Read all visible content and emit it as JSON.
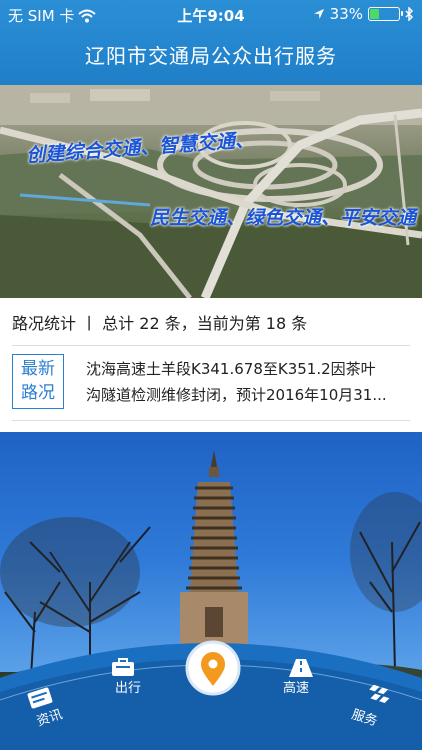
{
  "status_bar": {
    "carrier": "无 SIM 卡",
    "time": "上午9:04",
    "battery_text": "33%",
    "battery_level": 0.33,
    "icons": [
      "wifi-icon",
      "location-arrow-icon",
      "battery-icon",
      "bluetooth-icon"
    ]
  },
  "header": {
    "title": "辽阳市交通局公众出行服务"
  },
  "banner": {
    "slogan_line1": "创建综合交通、智慧交通、",
    "slogan_line2": "民生交通、绿色交通、平安交通",
    "slide_count": 2,
    "active_slide": 1
  },
  "stats": {
    "text": "路况统计 丨 总计 22 条，当前为第 18 条"
  },
  "news": {
    "badge_line1": "最新",
    "badge_line2": "路况",
    "line1": "沈海高速土羊段K341.678至K351.2因茶叶",
    "line2": "沟隧道检测维修封闭，预计2016年10月31..."
  },
  "nav": {
    "items": [
      {
        "label": "资讯",
        "icon": "news-icon"
      },
      {
        "label": "出行",
        "icon": "travel-bag-icon"
      },
      {
        "label": "",
        "icon": "location-pin-icon"
      },
      {
        "label": "高速",
        "icon": "highway-icon"
      },
      {
        "label": "服务",
        "icon": "service-icon"
      }
    ],
    "colors": {
      "arc": "#1a6fc0",
      "arc_dark": "#0f4f94",
      "center": "#f39a1e"
    }
  }
}
